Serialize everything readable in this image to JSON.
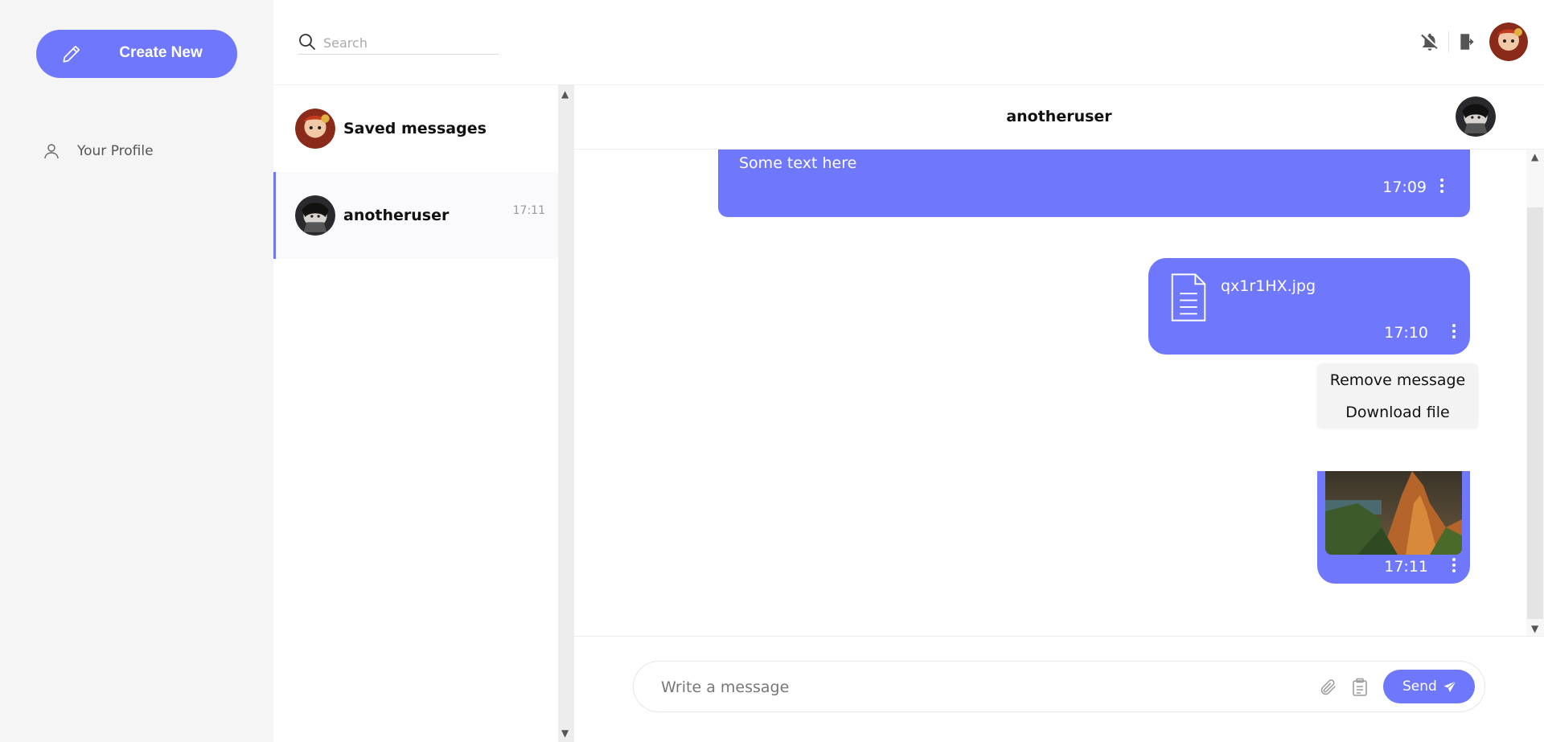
{
  "sidebar": {
    "create_label": "Create New",
    "profile_label": "Your Profile"
  },
  "header": {
    "search_placeholder": "Search"
  },
  "chats": [
    {
      "name": "Saved messages",
      "time": ""
    },
    {
      "name": "anotheruser",
      "time": "17:11",
      "active": true
    }
  ],
  "conversation": {
    "title": "anotheruser",
    "messages": [
      {
        "type": "text",
        "text": "Some text here",
        "time": "17:09"
      },
      {
        "type": "file",
        "filename": "qx1r1HX.jpg",
        "time": "17:10"
      },
      {
        "type": "image",
        "time": "17:11"
      }
    ],
    "context_menu": [
      "Remove message",
      "Download file"
    ]
  },
  "composer": {
    "placeholder": "Write a message",
    "send_label": "Send"
  },
  "colors": {
    "accent": "#6f78fc",
    "sidebar_bg": "#f5f5f5"
  },
  "icons": {
    "create": "pencil-icon",
    "profile": "user-icon",
    "search": "search-icon",
    "notifications": "bell-off-icon",
    "logout": "logout-icon",
    "file": "document-icon",
    "attach": "paperclip-icon",
    "clipboard": "clipboard-icon",
    "send": "paper-plane-icon",
    "menu": "kebab-icon"
  }
}
